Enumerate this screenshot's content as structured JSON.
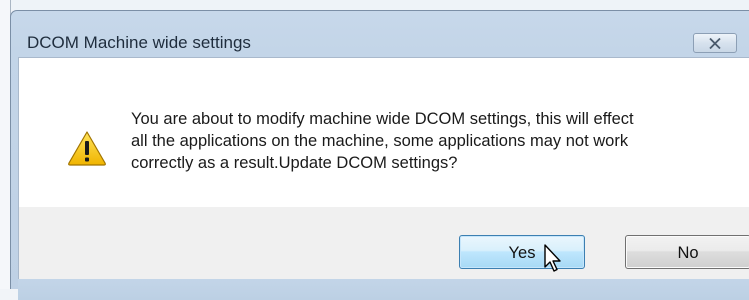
{
  "dialog": {
    "title": "DCOM Machine wide settings",
    "close_icon": "close-x-icon",
    "warning_icon": "warning-triangle-icon",
    "message_lines": [
      "You are about to modify machine wide DCOM settings, this will effect",
      "all the applications on the machine, some applications may not work",
      "correctly as a result.Update DCOM settings?"
    ],
    "buttons": {
      "yes_label": "Yes",
      "no_label": "No"
    },
    "cursor_icon": "mouse-pointer-icon",
    "colors": {
      "warning_fill": "#f5c400",
      "default_button_border": "#3c7fb1"
    }
  }
}
